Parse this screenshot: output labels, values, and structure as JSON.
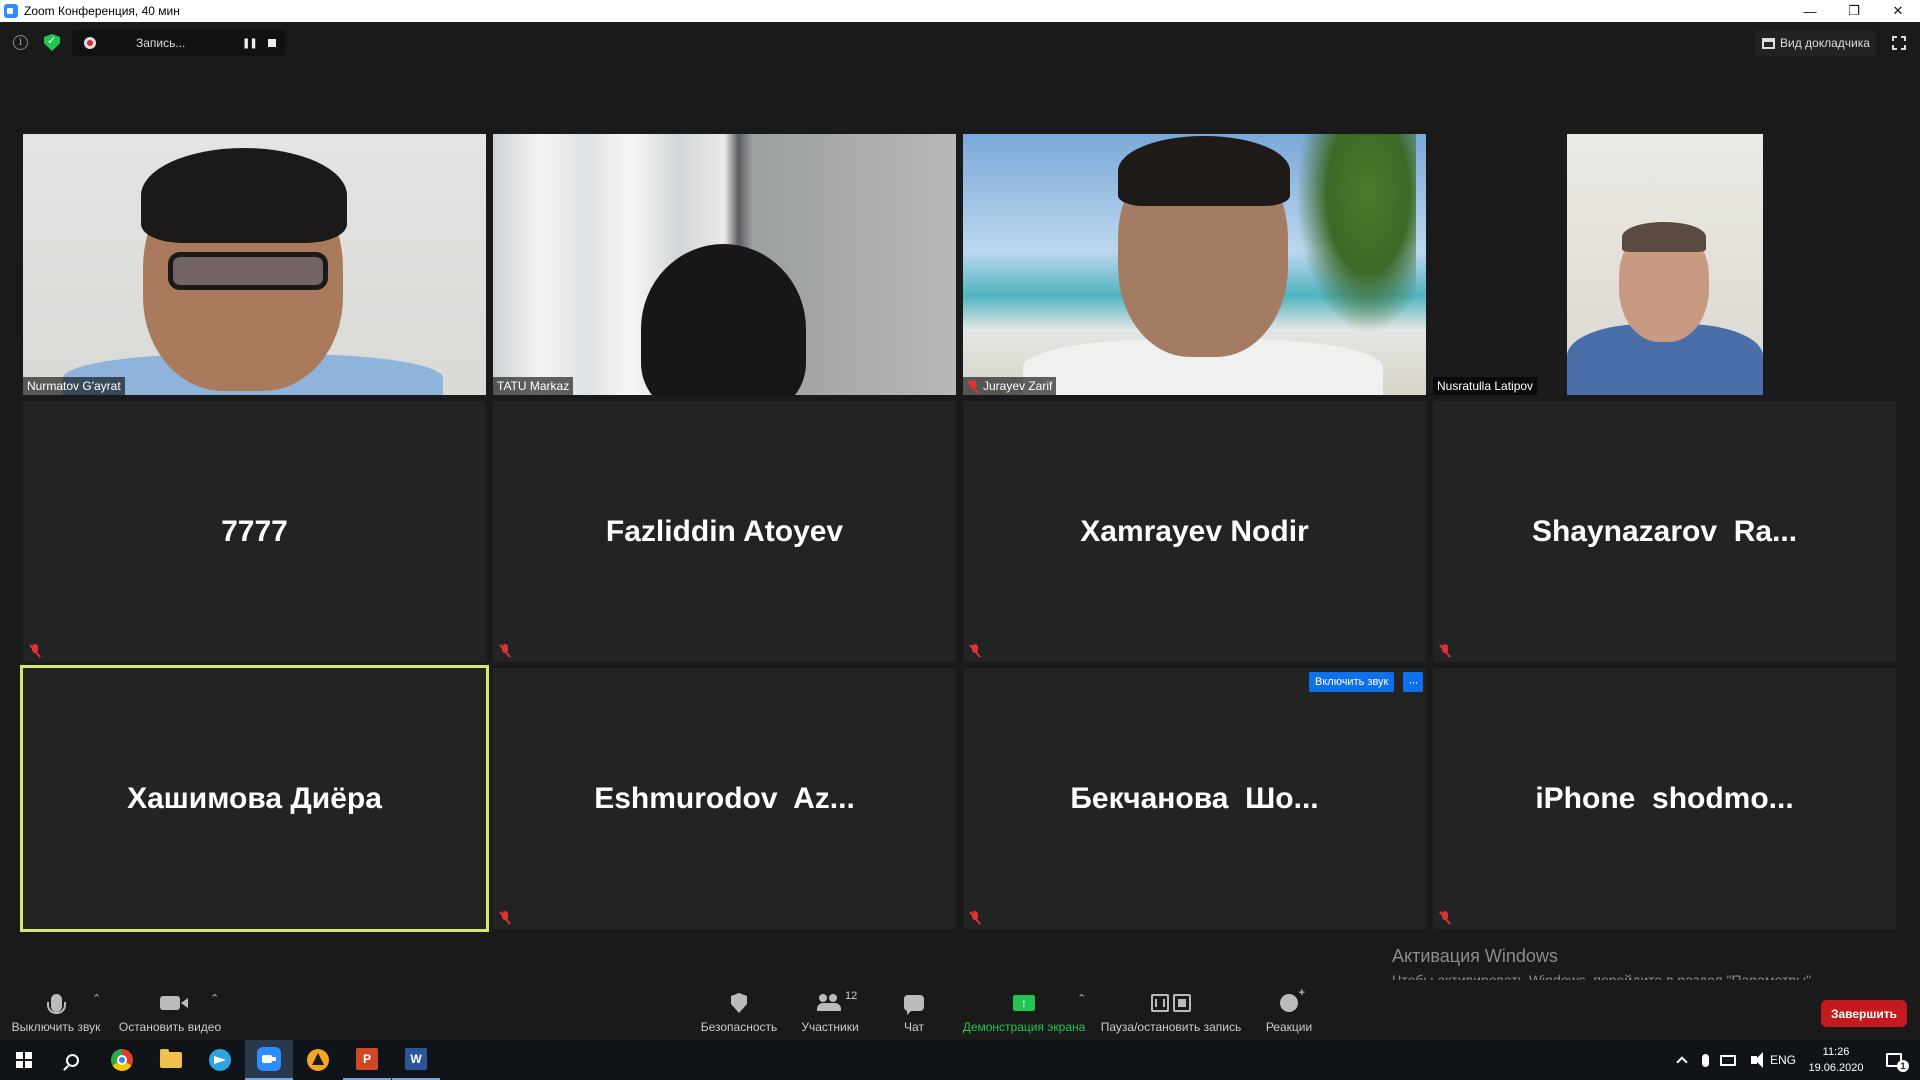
{
  "window": {
    "title": "Zoom Конференция, 40 мин",
    "controls": {
      "minimize": "—",
      "restore": "❐",
      "close": "✕"
    }
  },
  "topbar": {
    "recording_label": "Запись...",
    "speaker_view_label": "Вид докладчика"
  },
  "participants": [
    {
      "name": "Nurmatov G'ayrat",
      "video": true,
      "muted": false
    },
    {
      "name": "TATU Markaz",
      "video": true,
      "muted": false
    },
    {
      "name": "Jurayev Zarif",
      "video": true,
      "muted": true
    },
    {
      "name": "Nusratulla Latipov",
      "video": true,
      "muted": false
    },
    {
      "name": "7777",
      "video": false,
      "muted": true
    },
    {
      "name": "Fazliddin Atoyev",
      "video": false,
      "muted": true
    },
    {
      "name": "Xamrayev Nodir",
      "video": false,
      "muted": true
    },
    {
      "name": "Shaynazarov  Ra...",
      "video": false,
      "muted": true
    },
    {
      "name": "Хашимова Диёра",
      "video": false,
      "muted": false,
      "active_speaker": true
    },
    {
      "name": "Eshmurodov  Az...",
      "video": false,
      "muted": true
    },
    {
      "name": "Бекчанова  Шо...",
      "video": false,
      "muted": true
    },
    {
      "name": "iPhone  shodmo...",
      "video": false,
      "muted": true
    }
  ],
  "hover_actions": {
    "unmute_label": "Включить звук",
    "more_label": "···"
  },
  "watermark": {
    "title": "Активация Windows",
    "subtitle": "Чтобы активировать Windows, перейдите в раздел \"Параметры\"."
  },
  "toolbar": {
    "mute_label": "Выключить звук",
    "video_label": "Остановить видео",
    "security_label": "Безопасность",
    "participants_label": "Участники",
    "participants_count": "12",
    "chat_label": "Чат",
    "share_label": "Демонстрация экрана",
    "record_label": "Пауза/остановить запись",
    "reactions_label": "Реакции",
    "end_label": "Завершить",
    "caret": "⌃"
  },
  "taskbar": {
    "apps": [
      "start-icon",
      "search-icon",
      "chrome-icon",
      "explorer-icon",
      "telegram-icon",
      "zoom-icon",
      "aimp-icon",
      "powerpoint-icon",
      "word-icon"
    ],
    "ppt_letter": "P",
    "word_letter": "W",
    "language": "ENG",
    "time": "11:26",
    "date": "19.06.2020",
    "notifications": "1"
  },
  "colors": {
    "accent_blue": "#0e71eb",
    "share_green": "#23c552",
    "end_red": "#c41a1f",
    "active_speaker_border": "#d8e86e",
    "muted_red": "#dd3333"
  }
}
